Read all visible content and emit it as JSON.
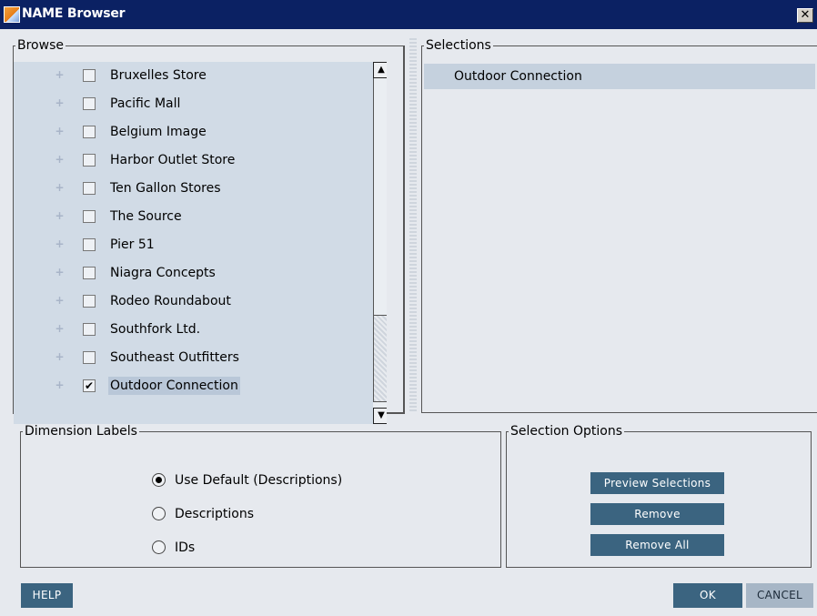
{
  "window": {
    "title": "NAME Browser",
    "close_glyph": "✕"
  },
  "browse": {
    "label": "Browse",
    "items": [
      {
        "label": "Bruxelles Store",
        "checked": false
      },
      {
        "label": "Pacific Mall",
        "checked": false
      },
      {
        "label": "Belgium Image",
        "checked": false
      },
      {
        "label": "Harbor Outlet Store",
        "checked": false
      },
      {
        "label": "Ten Gallon Stores",
        "checked": false
      },
      {
        "label": "The Source",
        "checked": false
      },
      {
        "label": "Pier 51",
        "checked": false
      },
      {
        "label": "Niagra Concepts",
        "checked": false
      },
      {
        "label": "Rodeo Roundabout",
        "checked": false
      },
      {
        "label": "Southfork Ltd.",
        "checked": false
      },
      {
        "label": "Southeast Outfitters",
        "checked": false
      },
      {
        "label": "Outdoor Connection",
        "checked": true
      }
    ],
    "expand_glyph": "+",
    "check_glyph": "✔",
    "scroll_up_glyph": "▲",
    "scroll_down_glyph": "▼"
  },
  "selections": {
    "label": "Selections",
    "items": [
      "Outdoor Connection"
    ]
  },
  "dimension_labels": {
    "label": "Dimension Labels",
    "options": [
      {
        "label": "Use Default (Descriptions)",
        "selected": true
      },
      {
        "label": "Descriptions",
        "selected": false
      },
      {
        "label": "IDs",
        "selected": false
      }
    ]
  },
  "selection_options": {
    "label": "Selection Options",
    "preview_label": "Preview Selections",
    "remove_label": "Remove",
    "remove_all_label": "Remove All"
  },
  "footer": {
    "help_label": "HELP",
    "ok_label": "OK",
    "cancel_label": "CANCEL"
  },
  "colors": {
    "title_bar": "#0b2163",
    "button": "#3b6480",
    "cancel_button": "#a7b6c6",
    "list_bg": "#d1dbe6"
  }
}
